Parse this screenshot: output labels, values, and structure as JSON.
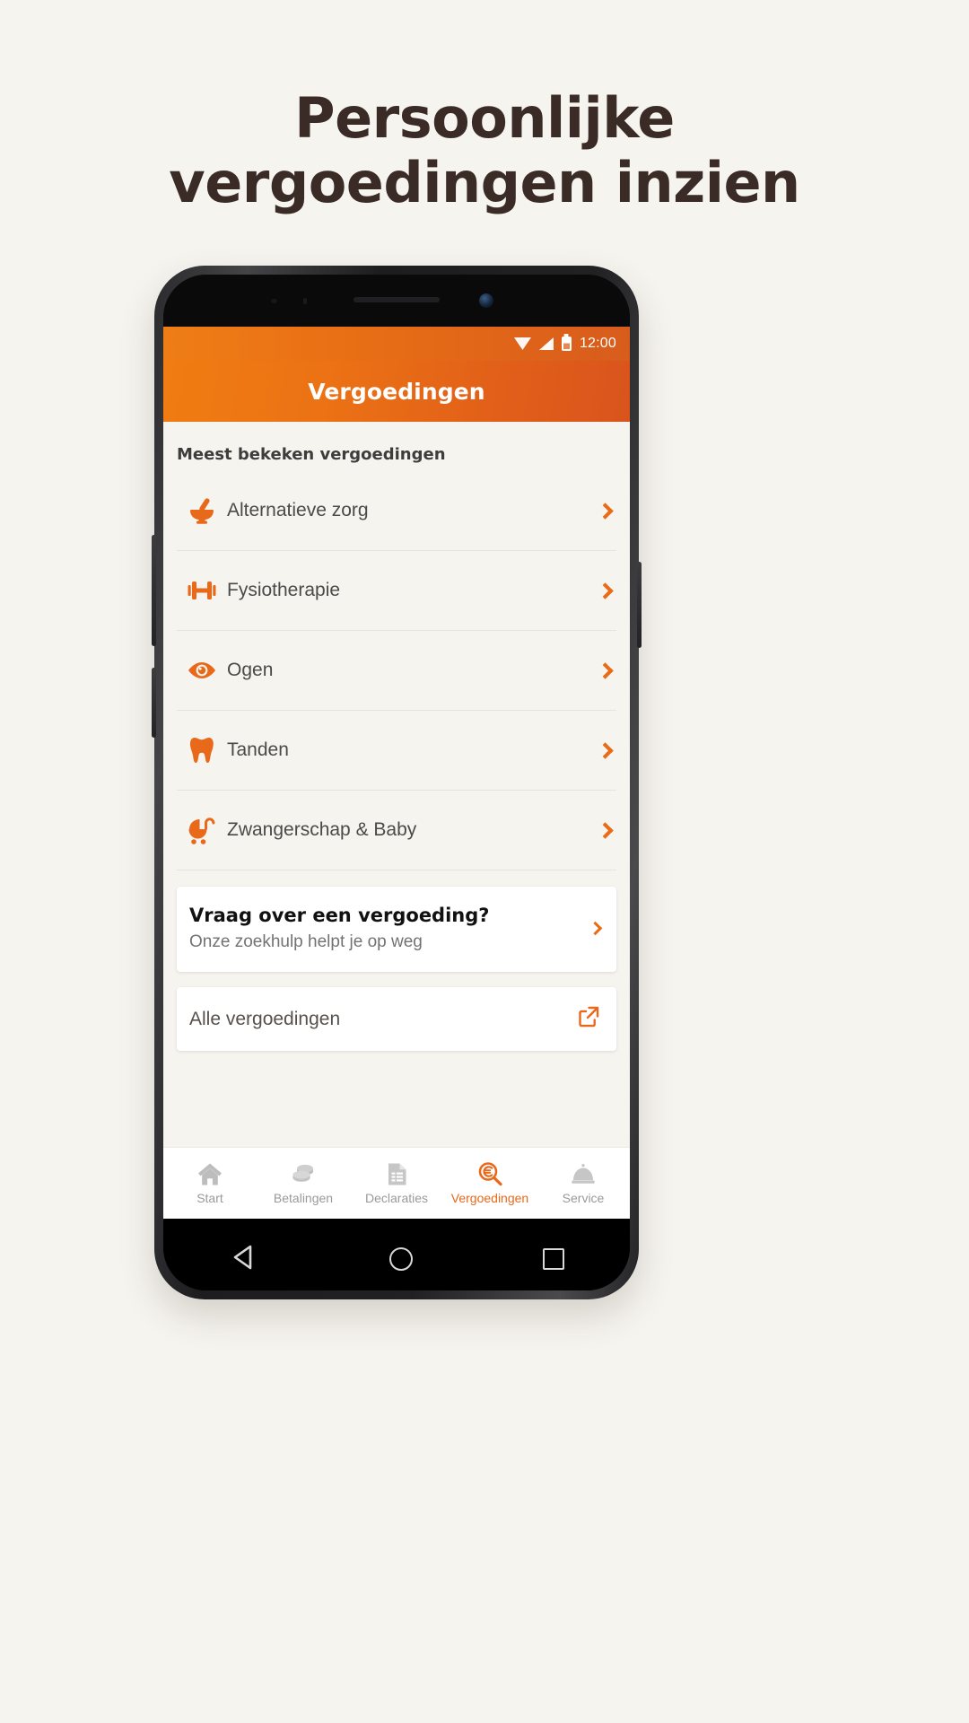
{
  "headline": {
    "line1": "Persoonlijke",
    "line2": "vergoedingen inzien"
  },
  "colors": {
    "page_bg": "#f6f4ef",
    "headline": "#3b2b26",
    "accent_orange": "#e8691a",
    "header_gradient_start": "#f07c12",
    "header_gradient_end": "#d9541d",
    "inactive_gray": "#9a9a9a"
  },
  "phone": {
    "statusbar": {
      "time": "12:00",
      "icons": [
        "wifi-icon",
        "signal-icon",
        "battery-icon"
      ]
    },
    "appbar": {
      "title": "Vergoedingen"
    },
    "content": {
      "section_title": "Meest bekeken vergoedingen",
      "items": [
        {
          "label": "Alternatieve zorg",
          "icon": "mortar-pestle-icon"
        },
        {
          "label": "Fysiotherapie",
          "icon": "dumbbell-icon"
        },
        {
          "label": "Ogen",
          "icon": "eye-icon"
        },
        {
          "label": "Tanden",
          "icon": "tooth-icon"
        },
        {
          "label": "Zwangerschap & Baby",
          "icon": "stroller-icon"
        }
      ],
      "help_card": {
        "title": "Vraag over een vergoeding?",
        "subtitle": "Onze zoekhulp helpt je op weg"
      },
      "all_card": {
        "title": "Alle vergoedingen",
        "icon": "external-link-icon"
      }
    },
    "tabbar": {
      "tabs": [
        {
          "label": "Start",
          "icon": "home-icon",
          "active": false
        },
        {
          "label": "Betalingen",
          "icon": "coins-icon",
          "active": false
        },
        {
          "label": "Declaraties",
          "icon": "document-icon",
          "active": false
        },
        {
          "label": "Vergoedingen",
          "icon": "euro-search-icon",
          "active": true
        },
        {
          "label": "Service",
          "icon": "service-bell-icon",
          "active": false
        }
      ]
    },
    "navbar": {
      "buttons": [
        "back-icon",
        "home-icon",
        "recents-icon"
      ]
    }
  }
}
